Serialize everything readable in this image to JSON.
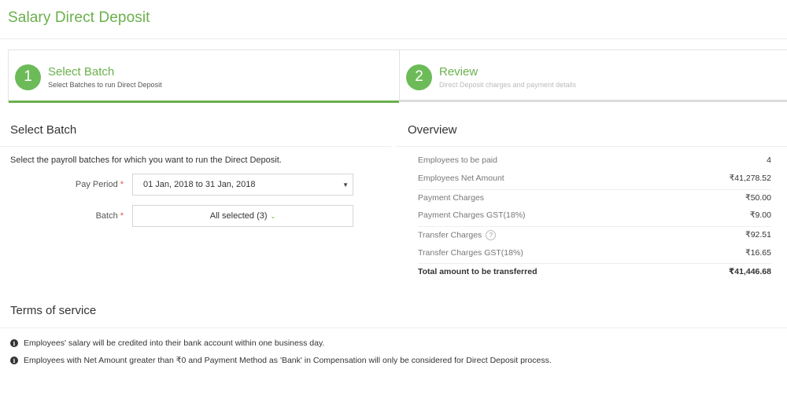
{
  "header": {
    "title": "Salary Direct Deposit"
  },
  "colors": {
    "accent": "#6ab04c",
    "step_circle": "#6cbb58",
    "required": "#d9534f"
  },
  "stepper": {
    "steps": [
      {
        "number": "1",
        "title": "Select Batch",
        "subtitle": "Select Batches to run Direct Deposit",
        "active": true
      },
      {
        "number": "2",
        "title": "Review",
        "subtitle": "Direct Deposit charges and payment details",
        "active": false
      }
    ]
  },
  "select_batch": {
    "title": "Select Batch",
    "intro": "Select the payroll batches for which you want to run the Direct Deposit.",
    "pay_period": {
      "label": "Pay Period",
      "required_mark": "*",
      "value": "01 Jan, 2018 to 31 Jan, 2018",
      "caret": "▼"
    },
    "batch": {
      "label": "Batch",
      "required_mark": "*",
      "value": "All selected (3)",
      "caret": "⌄"
    }
  },
  "overview": {
    "title": "Overview",
    "rows": [
      {
        "label": "Employees to be paid",
        "value": "4"
      },
      {
        "label": "Employees Net Amount",
        "value": "₹41,278.52"
      },
      {
        "label": "Payment Charges",
        "value": "₹50.00"
      },
      {
        "label": "Payment Charges GST(18%)",
        "value": "₹9.00"
      },
      {
        "label": "Transfer Charges",
        "value": "₹92.51",
        "help_icon": "?"
      },
      {
        "label": "Transfer Charges GST(18%)",
        "value": "₹16.65"
      },
      {
        "label": "Total amount to be transferred",
        "value": "₹41,446.68"
      }
    ]
  },
  "terms": {
    "title": "Terms of service",
    "info_icon": "i",
    "items": [
      "Employees' salary will be credited into their bank account within one business day.",
      "Employees with Net Amount greater than ₹0 and Payment Method as 'Bank' in Compensation will only be considered for Direct Deposit process."
    ]
  }
}
